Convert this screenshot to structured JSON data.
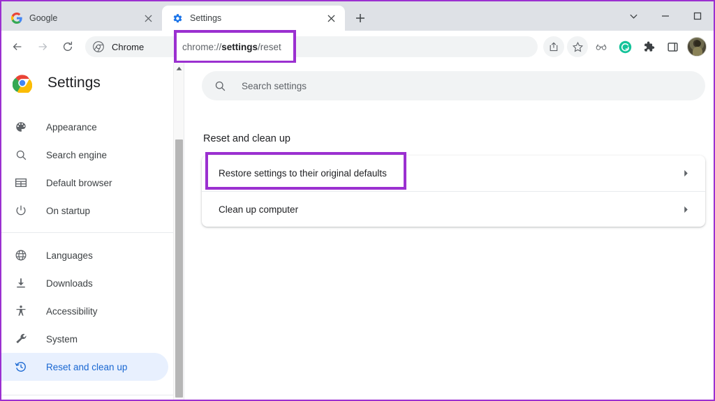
{
  "window": {
    "controls": [
      {
        "name": "tab-search",
        "glyph": "chevron-down-icon"
      },
      {
        "name": "minimize",
        "glyph": "minimize-icon"
      },
      {
        "name": "maximize",
        "glyph": "maximize-icon"
      }
    ]
  },
  "tabs": [
    {
      "title": "Google",
      "favicon": "google-g-icon",
      "active": false,
      "close_label": "×"
    },
    {
      "title": "Settings",
      "favicon": "settings-gear-icon",
      "active": true,
      "close_label": "×"
    }
  ],
  "newtab": {
    "label": "+",
    "tooltip": "New tab"
  },
  "toolbar": {
    "back_label": "←",
    "forward_label": "→",
    "reload_label": "⟳",
    "omnibox": {
      "chip_icon": "chrome-logo-icon",
      "chip_text": "Chrome",
      "url_prefix": "chrome://",
      "url_bold": "settings",
      "url_suffix": "/reset",
      "full_url": "chrome://settings/reset"
    },
    "icons": [
      {
        "name": "share-icon"
      },
      {
        "name": "bookmark-star-icon"
      },
      {
        "name": "reading-glasses-icon"
      },
      {
        "name": "grammarly-extension-icon",
        "color": "#15c39a",
        "letter": "G"
      },
      {
        "name": "extensions-puzzle-icon"
      },
      {
        "name": "side-panel-icon"
      },
      {
        "name": "profile-avatar"
      }
    ]
  },
  "settings": {
    "brand_title": "Settings",
    "brand_icon": "chrome-logo-icon",
    "search": {
      "icon": "search-icon",
      "placeholder": "Search settings",
      "value": ""
    },
    "sidebar_groups": [
      {
        "items": [
          {
            "label": "Appearance",
            "icon": "palette-icon",
            "selected": false
          },
          {
            "label": "Search engine",
            "icon": "magnifier-icon",
            "selected": false
          },
          {
            "label": "Default browser",
            "icon": "browser-window-icon",
            "selected": false
          },
          {
            "label": "On startup",
            "icon": "power-icon",
            "selected": false
          }
        ]
      },
      {
        "items": [
          {
            "label": "Languages",
            "icon": "globe-icon",
            "selected": false
          },
          {
            "label": "Downloads",
            "icon": "download-icon",
            "selected": false
          },
          {
            "label": "Accessibility",
            "icon": "accessibility-icon",
            "selected": false
          },
          {
            "label": "System",
            "icon": "wrench-icon",
            "selected": false
          },
          {
            "label": "Reset and clean up",
            "icon": "restore-clock-icon",
            "selected": true
          }
        ]
      }
    ],
    "section": {
      "title": "Reset and clean up",
      "rows": [
        {
          "label": "Restore settings to their original defaults",
          "arrow": "chevron-right-icon",
          "highlighted": true
        },
        {
          "label": "Clean up computer",
          "arrow": "chevron-right-icon",
          "highlighted": false
        }
      ]
    }
  },
  "annotations": {
    "highlight_color": "#9b30d0",
    "boxes": [
      {
        "target": "omnibox-url",
        "color": "#9b30d0"
      },
      {
        "target": "restore-settings-row",
        "color": "#9b30d0"
      }
    ]
  }
}
